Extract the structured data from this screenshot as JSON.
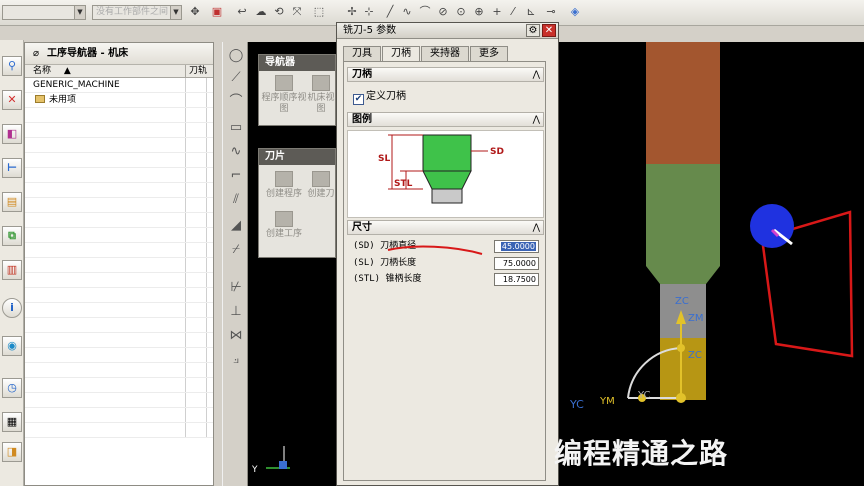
{
  "toolbar": {
    "combo1_value": "",
    "combo2_value": "没有工作部件之间"
  },
  "navigator": {
    "title": "工序导航器 - 机床",
    "col_name": "名称",
    "col_tool": "刀轨",
    "rows": [
      {
        "name": "GENERIC_MACHINE"
      },
      {
        "name": "未用项"
      }
    ]
  },
  "panels": {
    "navigator_panel": {
      "title": "导航器",
      "buttons": [
        "程序顺序视图",
        "机床视图"
      ]
    },
    "insert_panel": {
      "title": "刀片",
      "buttons": [
        "创建程序",
        "创建刀",
        "创建工序"
      ]
    }
  },
  "dialog": {
    "title": "铣刀-5 参数",
    "tabs": [
      "刀具",
      "刀柄",
      "夹持器",
      "更多"
    ],
    "active_tab": "刀柄",
    "sections": {
      "holder": "刀柄",
      "diagram": "图例",
      "dimensions": "尺寸"
    },
    "define_holder_label": "定义刀柄",
    "define_holder_checked": true,
    "diagram_labels": {
      "sd": "SD",
      "sl": "SL",
      "stl": "STL"
    },
    "dimensions": [
      {
        "label": "(SD) 刀柄直径",
        "value": "45.0000"
      },
      {
        "label": "(SL) 刀柄长度",
        "value": "75.0000"
      },
      {
        "label": "(STL) 锥柄长度",
        "value": "18.7500"
      }
    ]
  },
  "graphics": {
    "axis_labels": {
      "zc": "ZC",
      "zm": "ZM",
      "yc": "YC",
      "ym": "YM",
      "y": "Y"
    }
  },
  "subtitle": "编程精通之路",
  "colors": {
    "tool_shank": "#a3562f",
    "tool_body": "#668a4c",
    "tool_tip": "#b79614",
    "marker": "#1f32e0",
    "annotation": "#d81818"
  }
}
